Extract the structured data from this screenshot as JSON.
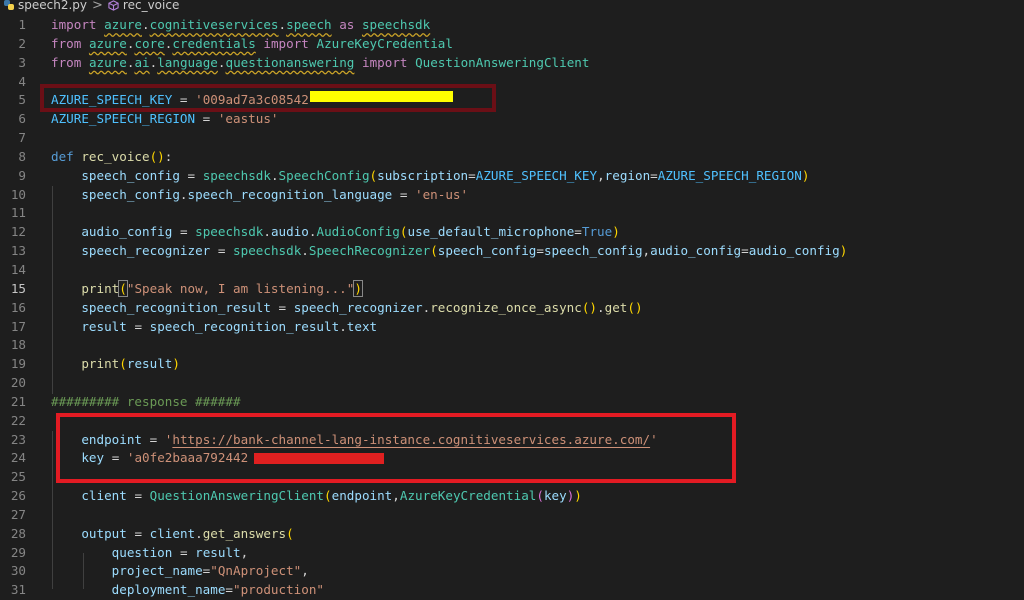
{
  "breadcrumb": {
    "file": "speech2.py",
    "separator": ">",
    "symbol": "rec_voice"
  },
  "lines": [
    {
      "n": "1",
      "t": "import azure.cognitiveservices.speech as speechsdk"
    },
    {
      "n": "2",
      "t": "from azure.core.credentials import AzureKeyCredential"
    },
    {
      "n": "3",
      "t": "from azure.ai.language.questionanswering import QuestionAnsweringClient"
    },
    {
      "n": "4",
      "t": ""
    },
    {
      "n": "5",
      "t": "AZURE_SPEECH_KEY = '009ad7a3c08542"
    },
    {
      "n": "6",
      "t": "AZURE_SPEECH_REGION = 'eastus'"
    },
    {
      "n": "7",
      "t": ""
    },
    {
      "n": "8",
      "t": "def rec_voice():"
    },
    {
      "n": "9",
      "t": "speech_config = speechsdk.SpeechConfig(subscription=AZURE_SPEECH_KEY,region=AZURE_SPEECH_REGION)"
    },
    {
      "n": "10",
      "t": "speech_config.speech_recognition_language = 'en-us'"
    },
    {
      "n": "11",
      "t": ""
    },
    {
      "n": "12",
      "t": "audio_config = speechsdk.audio.AudioConfig(use_default_microphone=True)"
    },
    {
      "n": "13",
      "t": "speech_recognizer = speechsdk.SpeechRecognizer(speech_config=speech_config,audio_config=audio_config)"
    },
    {
      "n": "14",
      "t": ""
    },
    {
      "n": "15",
      "t": "print(\"Speak now, I am listening...\")"
    },
    {
      "n": "16",
      "t": "speech_recognition_result = speech_recognizer.recognize_once_async().get()"
    },
    {
      "n": "17",
      "t": "result = speech_recognition_result.text"
    },
    {
      "n": "18",
      "t": ""
    },
    {
      "n": "19",
      "t": "print(result)"
    },
    {
      "n": "20",
      "t": ""
    },
    {
      "n": "21",
      "t": "######### response ######"
    },
    {
      "n": "22",
      "t": ""
    },
    {
      "n": "23",
      "t": "endpoint = 'https://bank-channel-lang-instance.cognitiveservices.azure.com/'"
    },
    {
      "n": "24",
      "t": "key = 'a0fe2baaa792442"
    },
    {
      "n": "25",
      "t": ""
    },
    {
      "n": "26",
      "t": "client = QuestionAnsweringClient(endpoint,AzureKeyCredential(key))"
    },
    {
      "n": "27",
      "t": ""
    },
    {
      "n": "28",
      "t": "output = client.get_answers("
    },
    {
      "n": "29",
      "t": "question = result,"
    },
    {
      "n": "30",
      "t": "project_name=\"QnAproject\","
    },
    {
      "n": "31",
      "t": "deployment_name=\"production\""
    }
  ],
  "active_line": "15",
  "colors": {
    "background": "#1e1e1e",
    "annotation_box_top": "#6b0f16",
    "annotation_box_bottom": "#e31b23",
    "redaction_top": "#ffff00",
    "redaction_bottom": "#e02020"
  },
  "icons": {
    "file": "python-file-icon",
    "symbol": "method-cube-icon"
  }
}
